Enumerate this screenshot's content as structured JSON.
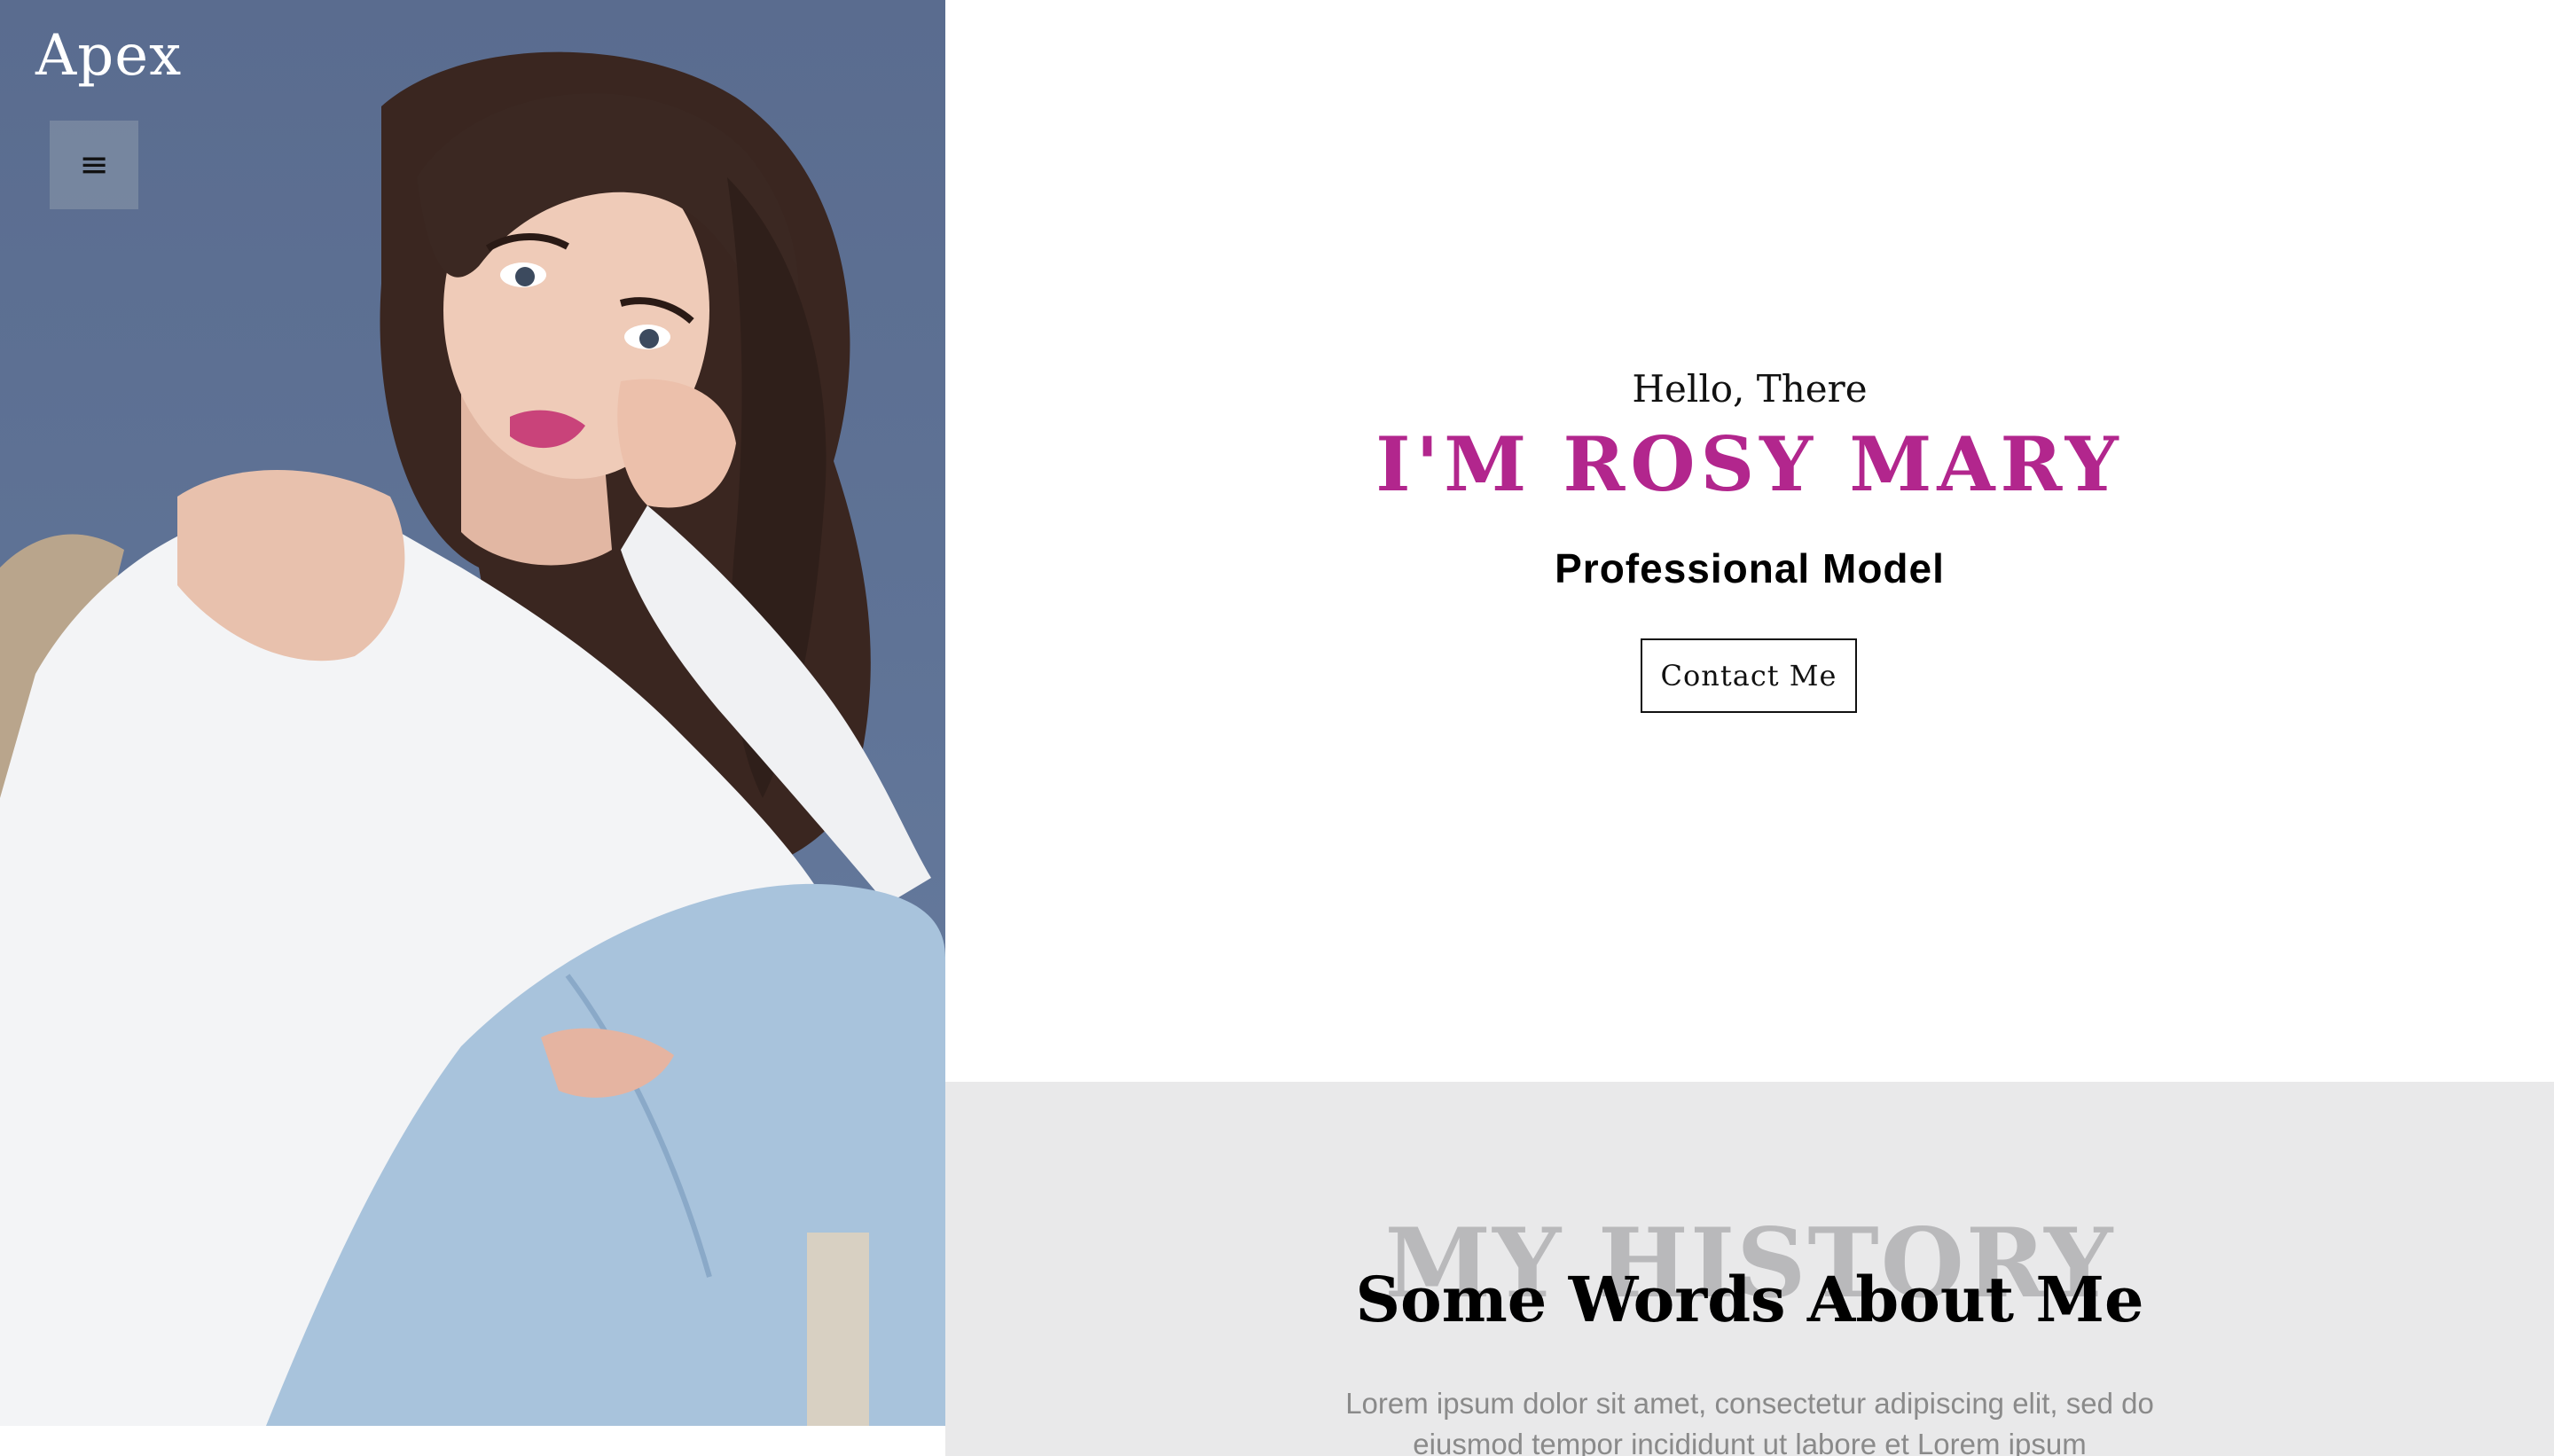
{
  "brand": {
    "logo_text": "Apex"
  },
  "nav": {
    "menu_icon": "≡",
    "menu_icon_name": "hamburger-menu-icon"
  },
  "hero": {
    "greeting": "Hello, There",
    "name": "I'M ROSY MARY",
    "role": "Professional Model",
    "contact_button": "Contact Me"
  },
  "about": {
    "watermark": "MY HISTORY",
    "title": "Some Words About Me",
    "text": "Lorem ipsum dolor sit amet, consectetur adipiscing elit, sed do eiusmod tempor incididunt ut labore et Lorem ipsum"
  },
  "colors": {
    "accent": "#b2268d",
    "photo_background": "#5f7396",
    "section_grey": "#e9e9ea",
    "body_text": "#8a8a8a"
  }
}
